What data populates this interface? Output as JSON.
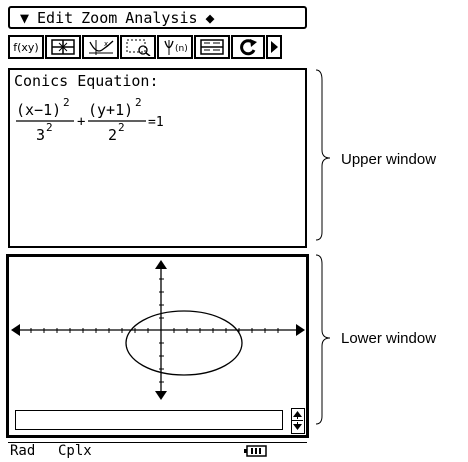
{
  "menu": {
    "chevron": "▼",
    "items": [
      "Edit",
      "Zoom",
      "Analysis"
    ],
    "extra": "◆"
  },
  "toolbar": {
    "fxy_label": "f(xy)"
  },
  "upper": {
    "title": "Conics Equation:",
    "eq": {
      "term1_num": "(x−1)",
      "term1_den": "3",
      "term2_num": "(y+1)",
      "term2_den": "2",
      "exp": "2",
      "plus": "+",
      "rhs": "=1"
    }
  },
  "status": {
    "angle": "Rad",
    "mode": "Cplx"
  },
  "annotations": {
    "upper": "Upper window",
    "lower": "Lower window"
  }
}
